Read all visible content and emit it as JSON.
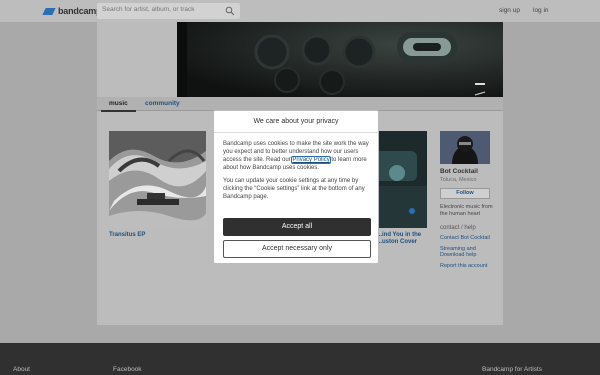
{
  "header": {
    "logo_text": "bandcamp",
    "search_placeholder": "Search for artist, album, or track",
    "signup_label": "sign up",
    "login_label": "log in"
  },
  "tabs": [
    {
      "label": "music",
      "active": true
    },
    {
      "label": "community",
      "active": false
    }
  ],
  "albums": [
    {
      "title": "Transitus EP"
    },
    {
      "title": "...ind You in the ...uston Cover"
    }
  ],
  "sidebar": {
    "artist_name": "Bot Cocktail",
    "location": "Toluca, Mexico",
    "follow_label": "Follow",
    "bio": "Electronic music from the human heart",
    "contact_heading": "contact / help",
    "links": [
      {
        "label": "Contact Bot Cocktail"
      },
      {
        "label": "Streaming and Download help"
      },
      {
        "label": "Report this account"
      }
    ]
  },
  "footer": {
    "links": [
      "About",
      "Facebook",
      "Bandcamp for Artists"
    ]
  },
  "cookie_modal": {
    "title": "We care about your privacy",
    "para1_before": "Bandcamp uses cookies to make the site work the way you expect and to better understand how our users access the site. Read our ",
    "privacy_link": "Privacy Policy",
    "para1_after": " to learn more about how Bandcamp uses cookies.",
    "para2": "You can update your cookie settings at any time by clicking the “Cookie settings” link at the bottom of any Bandcamp page.",
    "accept_all_label": "Accept all",
    "accept_necessary_label": "Accept necessary only"
  },
  "colors": {
    "brand_blue": "#2a6fb5",
    "link_blue": "#1d4f80",
    "dark_button": "#303030"
  }
}
